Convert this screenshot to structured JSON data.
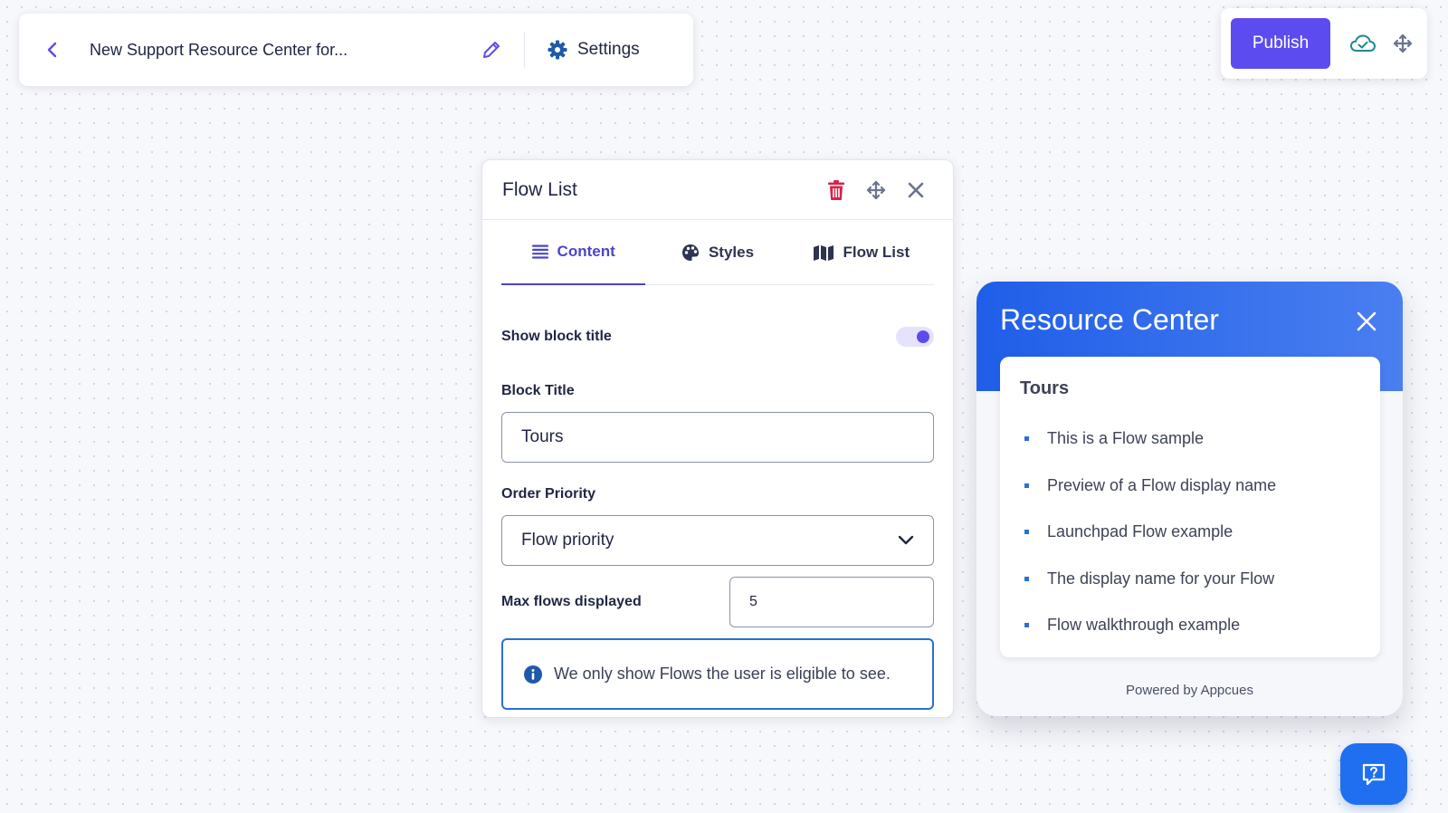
{
  "topbar": {
    "title": "New Support Resource Center for...",
    "settings_label": "Settings",
    "back_icon": "chevron-left-icon",
    "edit_icon": "pencil-icon",
    "settings_icon": "gear-icon"
  },
  "publishbar": {
    "publish_label": "Publish",
    "cloud_icon": "cloud-check-icon",
    "move_icon": "move-arrows-icon"
  },
  "panel": {
    "title": "Flow List",
    "tabs": [
      {
        "label": "Content",
        "icon": "list-icon",
        "active": true
      },
      {
        "label": "Styles",
        "icon": "palette-icon",
        "active": false
      },
      {
        "label": "Flow List",
        "icon": "map-icon",
        "active": false
      }
    ],
    "show_block_title_label": "Show block title",
    "show_block_title_enabled": true,
    "block_title_label": "Block Title",
    "block_title_value": "Tours",
    "order_priority_label": "Order Priority",
    "order_priority_value": "Flow priority",
    "max_flows_label": "Max flows displayed",
    "max_flows_value": "5",
    "info_text": "We only show Flows the user is eligible to see."
  },
  "resource_center": {
    "title": "Resource Center",
    "section_title": "Tours",
    "items": [
      "This is a Flow sample",
      "Preview of a Flow display name",
      "Launchpad Flow example",
      "The display name for your Flow",
      "Flow walkthrough example"
    ],
    "powered_by": "Powered by Appcues"
  },
  "colors": {
    "accent": "#5c4cf0",
    "brand_blue": "#1f5ee8",
    "danger": "#d6234a",
    "text": "#1f2544"
  }
}
